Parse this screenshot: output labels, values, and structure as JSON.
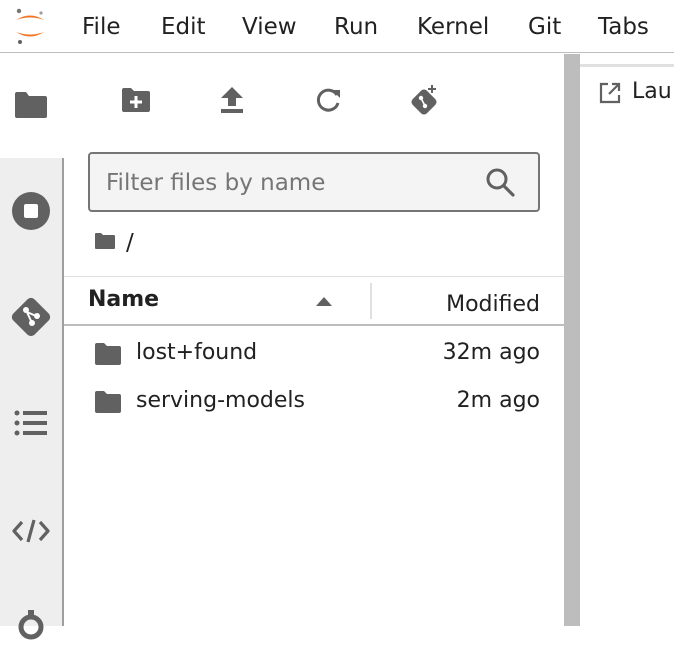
{
  "menubar": {
    "items": [
      "File",
      "Edit",
      "View",
      "Run",
      "Kernel",
      "Git",
      "Tabs"
    ]
  },
  "activity_bar": {
    "icons": [
      "folder-icon",
      "stop-circle-icon",
      "git-icon",
      "list-icon",
      "code-icon",
      "gear-icon"
    ]
  },
  "filebrowser": {
    "toolbar_icons": [
      "new-folder-icon",
      "upload-icon",
      "refresh-icon",
      "git-clone-icon"
    ],
    "filter": {
      "placeholder": "Filter files by name",
      "value": ""
    },
    "breadcrumb": {
      "path": "/"
    },
    "columns": {
      "name": "Name",
      "modified": "Modified"
    },
    "files": [
      {
        "name": "lost+found",
        "modified": "32m ago",
        "icon": "folder-icon"
      },
      {
        "name": "serving-models",
        "modified": "2m ago",
        "icon": "folder-icon"
      }
    ]
  },
  "tabs": [
    {
      "label": "Lau",
      "icon": "launch-icon"
    }
  ],
  "colors": {
    "logo_orange": "#F37726",
    "icon_gray": "#616161",
    "sidebar_bg": "#eeeeee",
    "splitter": "#bdbdbd"
  }
}
